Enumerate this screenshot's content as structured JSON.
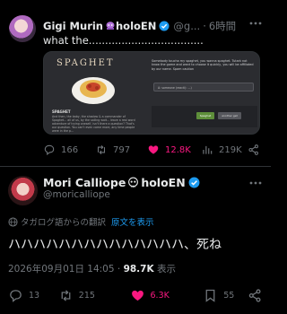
{
  "tweet1": {
    "display_name": "Gigi Murin",
    "display_suffix": "holoEN",
    "handle": "@g...",
    "time": "6時間",
    "text": "what the...................................",
    "media": {
      "title": "SPAGHET",
      "caption": "SPAGHET",
      "small_text": "And then, the baby, the shadow & a commander of Spaghet... all of us, by the sailing wait... leave a real word adventure of trying oneself, isn't there a question? That's our question. You can't even come more, any time people were in the p...",
      "right_text": "Somebody toucha my spaghet, you wanna spaghet. Tutarlı not know the game and want to choose it quickly, you will be affiliated by our name. Spam caution",
      "input_text": "A: someone (reacti): ...)",
      "button1": "Spaghet",
      "button2": "another get"
    },
    "stats": {
      "replies": "166",
      "retweets": "797",
      "likes": "12.8K",
      "views": "219K"
    }
  },
  "tweet2": {
    "display_name": "Mori Calliope",
    "display_suffix": "holoEN",
    "handle": "@moricalliope",
    "translate_label": "タガログ語からの翻訳",
    "show_original": "原文を表示",
    "text": "ハハハハハハハハハハハハハハ、死ね",
    "date": "2026年09月01日 14:05 · ",
    "views": "98.7K",
    "views_label": " 表示",
    "stats": {
      "replies": "13",
      "retweets": "215",
      "likes": "6.3K",
      "bookmarks": "55"
    }
  },
  "colors": {
    "background": "#000000",
    "text": "#e7e9ea",
    "muted": "#71767b",
    "accent": "#1d9bf0",
    "like": "#f91880"
  },
  "icons": [
    "more-icon",
    "verified-icon",
    "reply-icon",
    "retweet-icon",
    "like-icon",
    "views-icon",
    "bookmark-icon",
    "share-icon",
    "globe-icon"
  ]
}
